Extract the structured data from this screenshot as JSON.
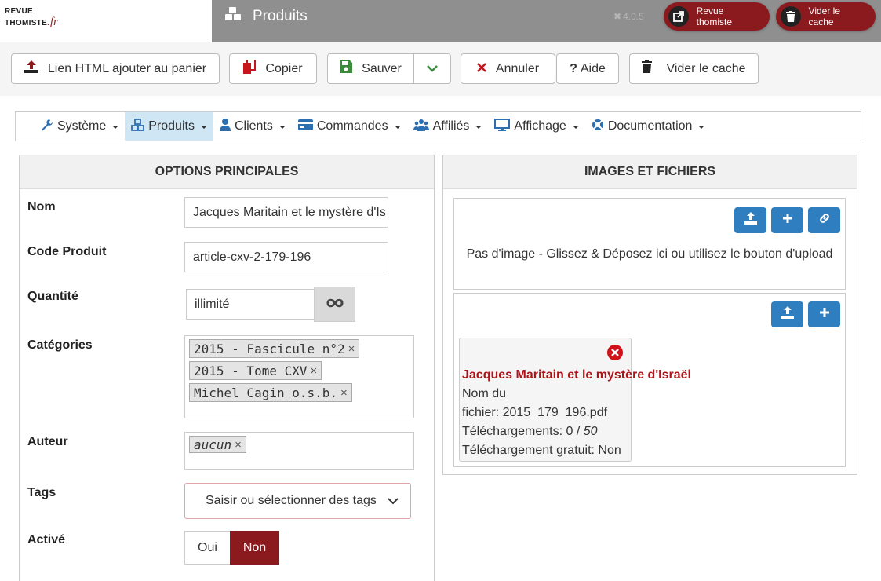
{
  "header": {
    "logo_line1": "REVUE",
    "logo_line2": "THOMISTE",
    "logo_suffix": ".fr",
    "title": "Produits",
    "version": "4.0.5",
    "pill_revue": "Revue thomiste",
    "pill_cache": "Vider le cache",
    "bar_color": "#8f8f8f",
    "accent": "#8b1a1f"
  },
  "toolbar": {
    "html_link": "Lien HTML ajouter au panier",
    "copy": "Copier",
    "save": "Sauver",
    "cancel": "Annuler",
    "help": "Aide",
    "clear_cache": "Vider le cache"
  },
  "menu": {
    "items": [
      {
        "label": "Système",
        "icon": "wrench-icon"
      },
      {
        "label": "Produits",
        "icon": "cubes-icon",
        "active": true
      },
      {
        "label": "Clients",
        "icon": "user-icon"
      },
      {
        "label": "Commandes",
        "icon": "credit-card-icon"
      },
      {
        "label": "Affiliés",
        "icon": "users-icon"
      },
      {
        "label": "Affichage",
        "icon": "desktop-icon"
      },
      {
        "label": "Documentation",
        "icon": "lifebuoy-icon"
      }
    ]
  },
  "options": {
    "heading": "OPTIONS PRINCIPALES",
    "name_label": "Nom",
    "name_value": "Jacques Maritain et le mystère d'Is",
    "code_label": "Code Produit",
    "code_value": "article-cxv-2-179-196",
    "qty_label": "Quantité",
    "qty_value": "illimité",
    "cat_label": "Catégories",
    "categories": [
      "2015 - Fascicule n°2",
      "2015 - Tome CXV",
      "Michel Cagin o.s.b."
    ],
    "author_label": "Auteur",
    "author_value": "aucun",
    "tags_label": "Tags",
    "tags_placeholder": "Saisir ou sélectionner des tags",
    "active_label": "Activé",
    "yes": "Oui",
    "no": "Non"
  },
  "files": {
    "heading": "IMAGES ET FICHIERS",
    "no_image": "Pas d'image - Glissez & Déposez ici ou utilisez le bouton d'upload",
    "file_title": "Jacques Maritain et le mystère d'Israël",
    "file_name_label": "Nom du",
    "file_name_value": "fichier: 2015_179_196.pdf",
    "downloads_label": "Téléchargements: 0 /",
    "downloads_max": "50",
    "free_label": "Téléchargement gratuit: Non"
  }
}
